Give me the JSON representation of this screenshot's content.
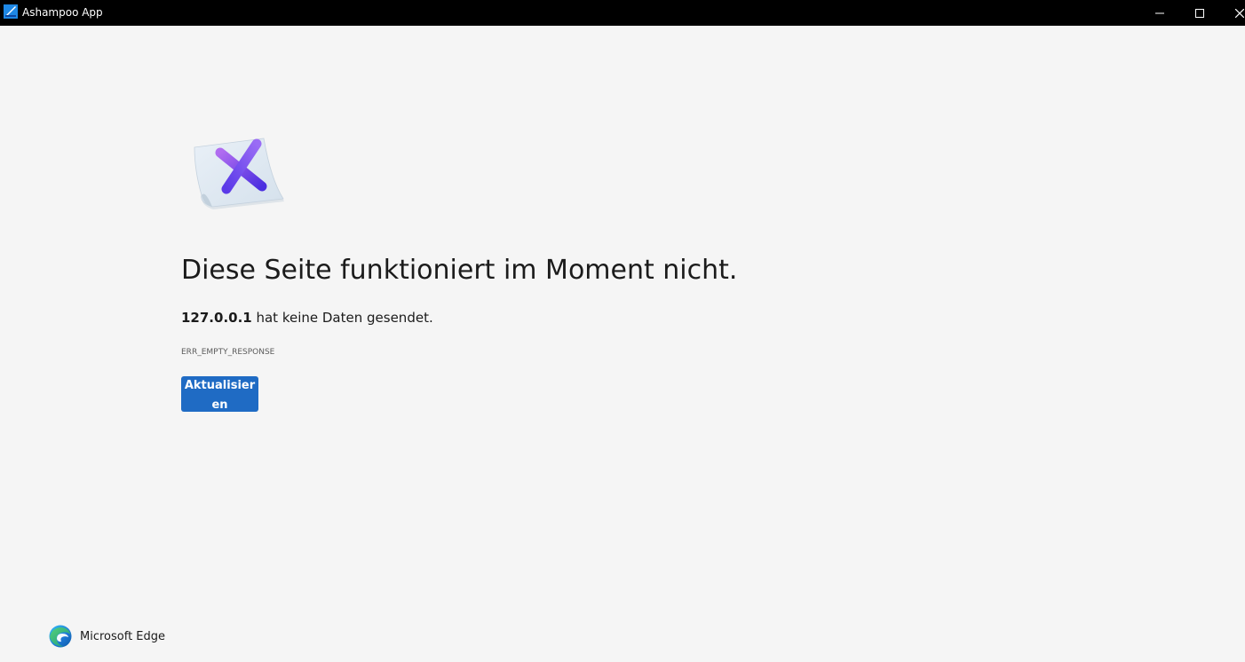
{
  "window": {
    "title": "Ashampoo App",
    "icon": "ashampoo-app-icon",
    "controls": {
      "minimize_icon": "minimize-icon",
      "maximize_icon": "maximize-icon",
      "close_icon": "close-icon"
    }
  },
  "error_page": {
    "illustration_icon": "error-x-icon",
    "heading": "Diese Seite funktioniert im Moment nicht.",
    "host": "127.0.0.1",
    "message": " hat keine Daten gesendet.",
    "error_code": "ERR_EMPTY_RESPONSE",
    "reload_button_label": "Aktualisieren"
  },
  "footer": {
    "browser_name": "Microsoft Edge",
    "browser_icon": "edge-logo-icon"
  },
  "colors": {
    "titlebar_bg": "#000000",
    "page_bg": "#f5f5f5",
    "button_bg": "#1f6bc4",
    "text": "#1b1b1b"
  }
}
